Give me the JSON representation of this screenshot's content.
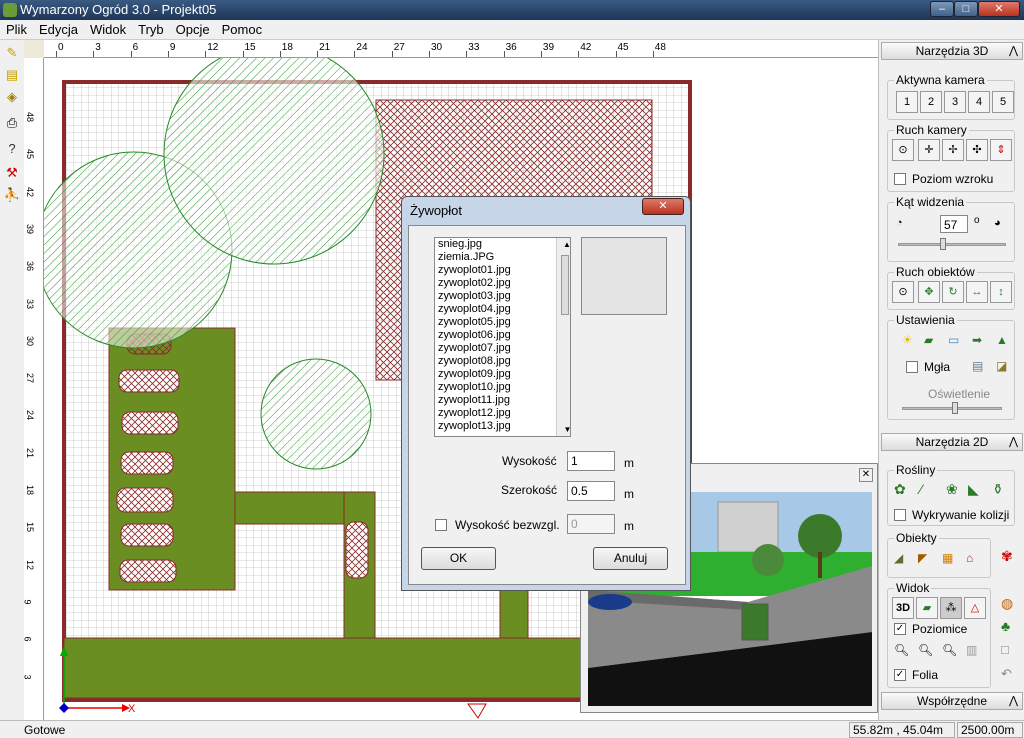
{
  "window": {
    "title": "Wymarzony Ogród 3.0 - Projekt05",
    "minimize": "–",
    "maximize": "□",
    "close": "✕"
  },
  "menu": [
    "Plik",
    "Edycja",
    "Widok",
    "Tryb",
    "Opcje",
    "Pomoc"
  ],
  "ruler_top": [
    "0",
    "3",
    "6",
    "9",
    "12",
    "15",
    "18",
    "21",
    "24",
    "27",
    "30",
    "33",
    "36",
    "39",
    "42",
    "45",
    "48"
  ],
  "ruler_left": [
    "48",
    "45",
    "42",
    "39",
    "36",
    "33",
    "30",
    "27",
    "24",
    "21",
    "18",
    "15",
    "12",
    "9",
    "6",
    "3"
  ],
  "canvas": {
    "axis_x": "X"
  },
  "right_panel": {
    "tools3d": {
      "header": "Narzędzia 3D"
    },
    "camera": {
      "label": "Aktywna kamera",
      "buttons": [
        "1",
        "2",
        "3",
        "4",
        "5"
      ]
    },
    "camera_move": {
      "label": "Ruch kamery",
      "eye_level": "Poziom wzroku"
    },
    "fov": {
      "label": "Kąt widzenia",
      "value": "57",
      "unit": "o"
    },
    "obj_move": {
      "label": "Ruch obiektów"
    },
    "settings": {
      "label": "Ustawienia",
      "fog": "Mgła",
      "lighting": "Oświetlenie"
    },
    "tools2d": {
      "header": "Narzędzia 2D"
    },
    "plants": {
      "label": "Rośliny",
      "collision": "Wykrywanie kolizji"
    },
    "objects": {
      "label": "Obiekty"
    },
    "view": {
      "label": "Widok",
      "btn3d": "3D",
      "contours": "Poziomice",
      "foil": "Folia"
    },
    "coords": {
      "header": "Współrzędne"
    }
  },
  "dialog": {
    "title": "Żywopłot",
    "files": [
      "snieg.jpg",
      "ziemia.JPG",
      "zywoplot01.jpg",
      "zywoplot02.jpg",
      "zywoplot03.jpg",
      "zywoplot04.jpg",
      "zywoplot05.jpg",
      "zywoplot06.jpg",
      "zywoplot07.jpg",
      "zywoplot08.jpg",
      "zywoplot09.jpg",
      "zywoplot10.jpg",
      "zywoplot11.jpg",
      "zywoplot12.jpg",
      "zywoplot13.jpg"
    ],
    "height_label": "Wysokość",
    "height_value": "1",
    "height_unit": "m",
    "width_label": "Szerokość",
    "width_value": "0.5",
    "width_unit": "m",
    "abs_label": "Wysokość bezwzgl.",
    "abs_value": "0",
    "abs_unit": "m",
    "ok": "OK",
    "cancel": "Anuluj"
  },
  "status": {
    "text": "Gotowe",
    "coords": "55.82m , 45.04m",
    "zoom": "2500.00m"
  },
  "colors": {
    "grass": "#6b8e23",
    "hatch": "#8b2a2a",
    "tree": "#228b22"
  }
}
